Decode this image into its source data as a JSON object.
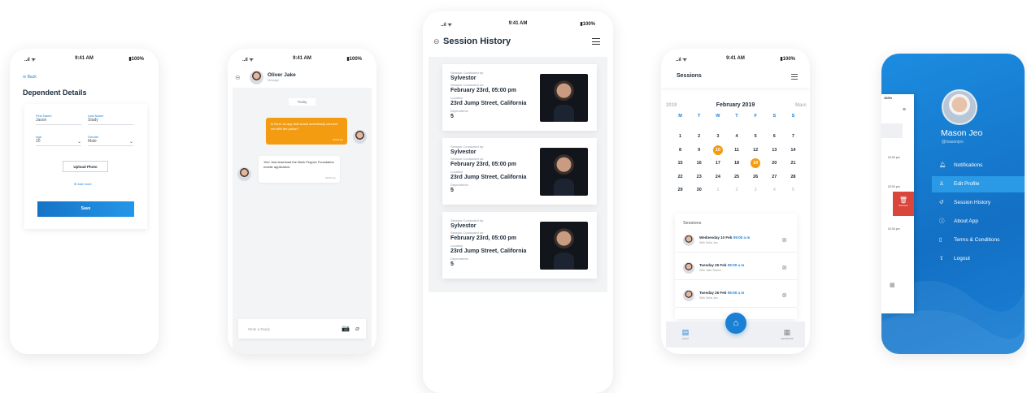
{
  "status": {
    "time": "9:41 AM",
    "battery": "100%",
    "signal": "..ıl ᯤ"
  },
  "screen1": {
    "back_label": "Back",
    "title": "Dependent Details",
    "first_name_label": "First Name",
    "first_name_value": "Jason",
    "last_name_label": "Last Name",
    "last_name_value": "Stady",
    "age_label": "Age",
    "age_value": "20",
    "gender_label": "Gender",
    "gender_value": "Male",
    "upload_label": "Upload Photo",
    "add_more_label": "Add more",
    "save_label": "Save"
  },
  "screen2": {
    "contact_name": "Oliver Jake",
    "contact_status": "Message",
    "date_divider": "Today",
    "msg_out": "Is there an app that would seamlessly connect me with the police?",
    "msg_out_time": "09:00 pm",
    "msg_in": "Yes! Just download the Mark Peppes Foundation mobile application.",
    "msg_in_time": "09:00 pm",
    "reply_placeholder": "Write a Reply"
  },
  "screen3": {
    "title": "Session History",
    "cards": [
      {
        "by_label": "Session Conducted by:",
        "name": "Sylvestor",
        "on_label": "Session Conducted on:",
        "date": "February 23rd, 05:00 pm",
        "loc_label": "Location",
        "location": "23rd Jump Street, California",
        "dep_label": "Dependents",
        "dependents": "5"
      },
      {
        "by_label": "Session Conducted by:",
        "name": "Sylvestor",
        "on_label": "Session Conducted on:",
        "date": "February 23rd, 05:00 pm",
        "loc_label": "Location",
        "location": "23rd Jump Street, California",
        "dep_label": "Dependents",
        "dependents": "5"
      },
      {
        "by_label": "Session Conducted by:",
        "name": "Sylvestor",
        "on_label": "Session Conducted on:",
        "date": "February 23rd, 05:00 pm",
        "loc_label": "Location",
        "location": "23rd Jump Street, California",
        "dep_label": "Dependents",
        "dependents": "5"
      }
    ]
  },
  "screen4": {
    "title": "Sessions",
    "prev_month": "2019",
    "month": "February 2019",
    "next_month": "Marc",
    "weekdays": [
      "M",
      "T",
      "W",
      "T",
      "F",
      "S",
      "S"
    ],
    "weeks": [
      [
        "1",
        "2",
        "3",
        "4",
        "5",
        "6",
        "7"
      ],
      [
        "8",
        "9",
        "10",
        "11",
        "12",
        "13",
        "14"
      ],
      [
        "15",
        "16",
        "17",
        "18",
        "19",
        "20",
        "21"
      ],
      [
        "22",
        "23",
        "24",
        "25",
        "26",
        "27",
        "28"
      ],
      [
        "29",
        "30",
        "1",
        "2",
        "3",
        "4",
        "5"
      ]
    ],
    "highlighted_days": [
      "10",
      "19"
    ],
    "sessions_label": "Sessions",
    "sessions": [
      {
        "day": "Wednesday 10 Feb",
        "time": "09:00 a m",
        "with": "With Della Jea"
      },
      {
        "day": "Tuesday 26 Feb",
        "time": "09:00 a m",
        "with": "With Jake Sbarro"
      },
      {
        "day": "Tuesday 26 Feb",
        "time": "09:00 a m",
        "with": "With Della Jea"
      }
    ],
    "nav_chat": "CHAT",
    "nav_sessions": "SESSIONS",
    "accent": "#f39c12"
  },
  "screen5": {
    "user_name": "Mason Jeo",
    "user_handle": "@masonjeo",
    "menu": [
      {
        "label": "Notifications",
        "icon": "bell-icon"
      },
      {
        "label": "Edit Profile",
        "icon": "user-icon"
      },
      {
        "label": "Session History",
        "icon": "history-icon"
      },
      {
        "label": "About App",
        "icon": "info-icon"
      },
      {
        "label": "Terms & Conditions",
        "icon": "document-icon"
      },
      {
        "label": "Logout",
        "icon": "logout-icon"
      }
    ],
    "peek_time_1": "02:00 pm",
    "peek_time_2": "02:00 pm",
    "peek_time_3": "02:00 pm",
    "remove_label": "Remove",
    "brand": "#1b7fd4"
  }
}
